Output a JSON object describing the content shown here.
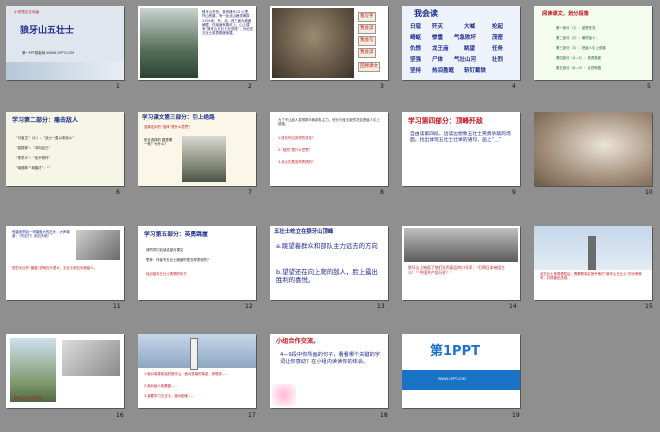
{
  "slides": [
    {
      "num": "1",
      "grade": "小学语文五年级",
      "title": "狼牙山五壮士",
      "footer": "第一PPT模板网-WWW.1PPT.COM"
    },
    {
      "num": "2",
      "text": "狼牙山东西，各有峰头15 公里，环山有路，有一处北山峰顶海拔1105米。东、北、西三面为悬崖峭壁，仅南面有路可上。山上建有“狼牙山五壮士纪念塔”，为纪念五壮士英勇跳崖而建。"
    },
    {
      "num": "3",
      "buttons": [
        "我写字",
        "我会读",
        "我会写",
        "我会读",
        "回顾课文"
      ]
    },
    {
      "num": "4",
      "title": "我会读",
      "words": [
        "日寇",
        "歼灭",
        "大喊",
        "抡起",
        "崎岖",
        "惨重",
        "气急败坏",
        "茂密",
        "仇恨",
        "龙王庙",
        "眺望",
        "任务",
        "坚强",
        "尸体",
        "气壮山河",
        "壮烈",
        "坚持",
        "热泪盈眶",
        "斩钉截铁"
      ]
    },
    {
      "num": "5",
      "title": "阅读课文，划分段落",
      "parts": [
        "第一部分（1）：接受任务",
        "第二部分（2）：痛歼敌人",
        "第三部分（3）：把敌人引上绝路",
        "第四部分（4—5）：英勇跳崖",
        "第五部分（6—9）：壮烈殉国"
      ]
    },
    {
      "num": "6",
      "title": "学习第二部分：痛击敌人",
      "lines": [
        "“马宝玉”（小）：“战士一直以来战斗”",
        "“葛振林”：“冲向自己”",
        "“宋学义”：“也不例外”",
        "“胡德林”“胡福才”：“”"
      ]
    },
    {
      "num": "7",
      "title": "学习课文第三部分：引上绝路",
      "question": "选择这中的“选择”是什么意思？",
      "side": "班长选择的 路是哪一条？为什么？"
    },
    {
      "num": "8",
      "lines": [
        "为了不让敌人发现群众和部队主力，班长马宝玉毅然决定把敌人引上绝路。",
        "1.班长作出怎样的决定？",
        "2.“毅然”是什么意思？",
        "3.战士们是怎样表现的？"
      ]
    },
    {
      "num": "9",
      "title": "学习第四部分：顶峰歼敌",
      "text": "自由读第四段，边读边想象五壮士英勇杀敌的场面。找出体现五壮士壮举的语句，画上“＿”"
    },
    {
      "num": "10"
    },
    {
      "num": "11",
      "text": "他猛地举起一块磨盘大的石头，大声喊道：“同志们！用石头砸！”",
      "text2": "把石头比作“磨盘”说明石头很大，五壮士用石头砸敌人。"
    },
    {
      "num": "12",
      "title": "学习第五部分：英勇跳崖",
      "lines": [
        "请同学们自读这部分课文",
        "思考：作者写五壮士跳崖时是怎样表现的？",
        "找出描写五壮士表情的句子"
      ]
    },
    {
      "num": "13",
      "title": "五壮士屹立在狼牙山顶峰",
      "a": "a.眺望着群众和部队主力远去的方向",
      "b": "b.望望还在向上爬的敌人，脸上露出胜利的喜悦。"
    },
    {
      "num": "14",
      "text": "狼牙山上响起了他们壮烈豪迈的口号声：“打倒日本帝国主义！”“中国共产党万岁！”"
    },
    {
      "num": "15",
      "text": "这五壮士英勇牺牲后，晋察冀军区授予他们“狼牙山五壮士”的光荣称号，并修建纪念塔。"
    },
    {
      "num": "16",
      "caption": "狼牙山壮士纪念塔"
    },
    {
      "num": "17",
      "lines": [
        "1.面对英雄而高的狼牙山，面对英雄的事迹，我想说……",
        "2.面对敌人我要做……",
        "3.我要学习五壮士，面对困难……"
      ]
    },
    {
      "num": "18",
      "title": "小组合作交流。",
      "text": "4—9段中你所画的句子，看看哪个关键的字词让你感动？在小组内读读你的体会。"
    },
    {
      "num": "19",
      "logo": "第1PPT",
      "sub": "WWW.1PPT.COM"
    }
  ]
}
